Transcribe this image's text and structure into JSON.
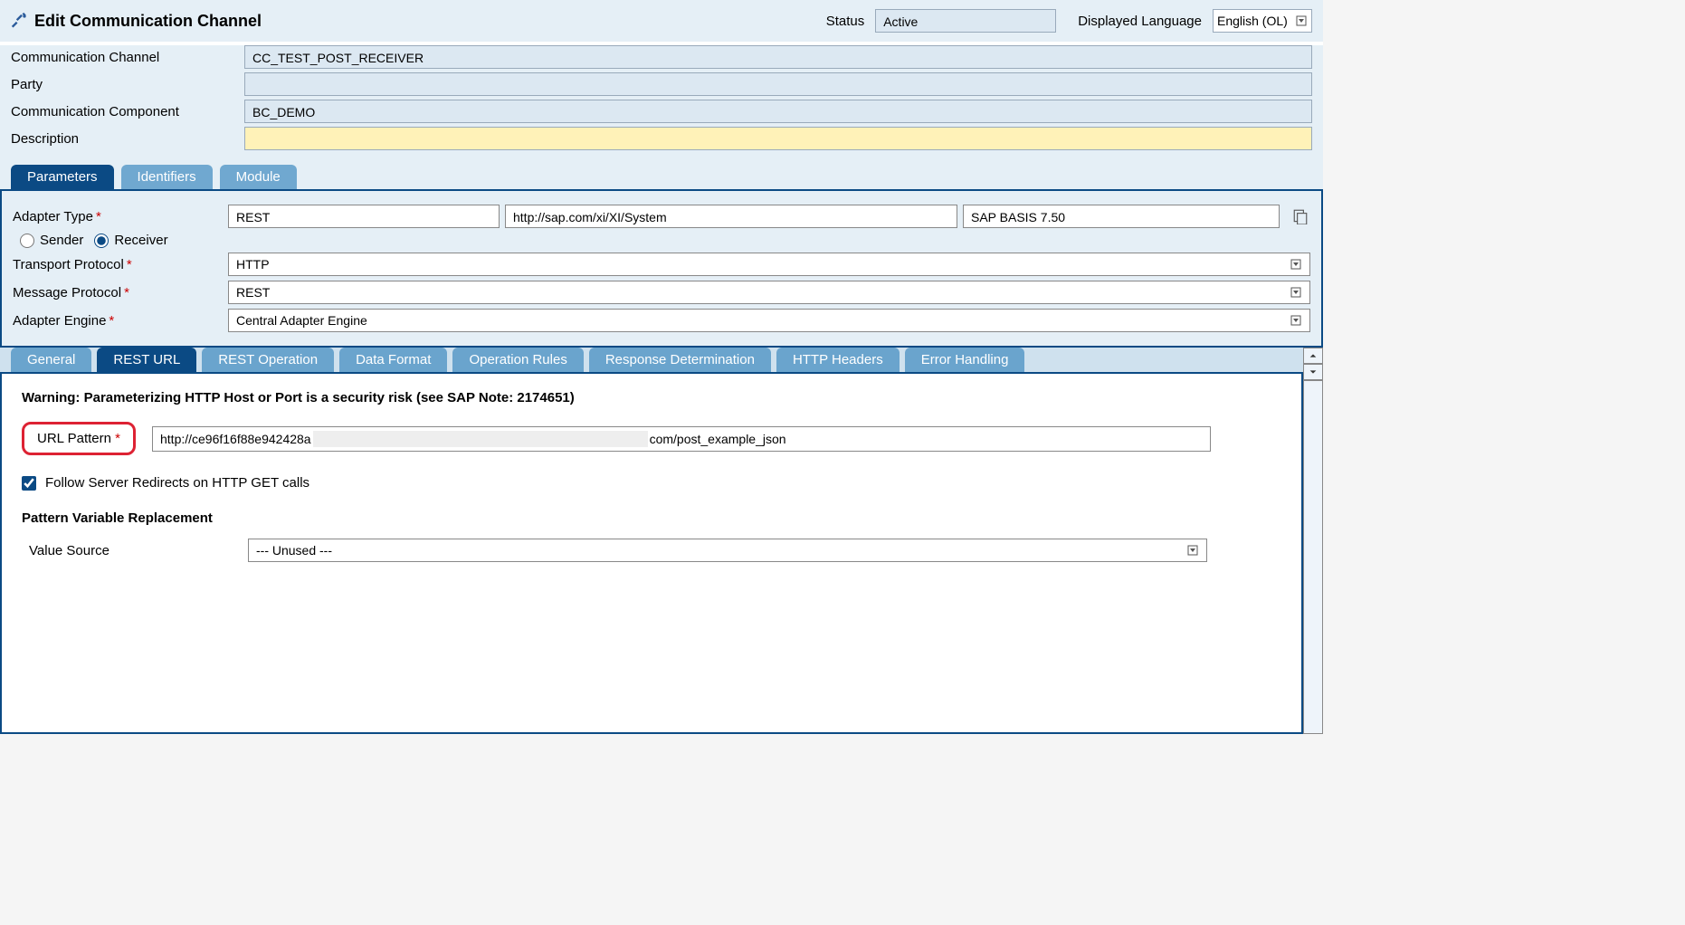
{
  "header": {
    "title": "Edit Communication Channel",
    "status_label": "Status",
    "status_value": "Active",
    "displayed_language_label": "Displayed Language",
    "displayed_language_value": "English (OL)"
  },
  "form": {
    "comm_channel_label": "Communication Channel",
    "comm_channel_value": "CC_TEST_POST_RECEIVER",
    "party_label": "Party",
    "party_value": "",
    "comm_component_label": "Communication Component",
    "comm_component_value": "BC_DEMO",
    "description_label": "Description",
    "description_value": ""
  },
  "tabs_top": {
    "parameters": "Parameters",
    "identifiers": "Identifiers",
    "module": "Module"
  },
  "params": {
    "adapter_type_label": "Adapter Type",
    "adapter_type_value": "REST",
    "adapter_namespace": "http://sap.com/xi/XI/System",
    "adapter_version": "SAP BASIS 7.50",
    "sender_label": "Sender",
    "receiver_label": "Receiver",
    "transport_protocol_label": "Transport Protocol",
    "transport_protocol_value": "HTTP",
    "message_protocol_label": "Message Protocol",
    "message_protocol_value": "REST",
    "adapter_engine_label": "Adapter Engine",
    "adapter_engine_value": "Central Adapter Engine"
  },
  "tabs_sub": {
    "general": "General",
    "rest_url": "REST URL",
    "rest_operation": "REST Operation",
    "data_format": "Data Format",
    "operation_rules": "Operation Rules",
    "response_determination": "Response Determination",
    "http_headers": "HTTP Headers",
    "error_handling": "Error Handling"
  },
  "rest_url": {
    "warning": "Warning: Parameterizing HTTP Host or Port is a security risk (see SAP Note: 2174651)",
    "url_pattern_label": "URL Pattern",
    "url_pattern_prefix": "http://ce96f16f88e942428a",
    "url_pattern_suffix": "com/post_example_json",
    "follow_redirects_label": "Follow Server Redirects on HTTP GET calls",
    "pattern_var_replacement_label": "Pattern Variable Replacement",
    "value_source_label": "Value Source",
    "value_source_value": "--- Unused ---"
  }
}
